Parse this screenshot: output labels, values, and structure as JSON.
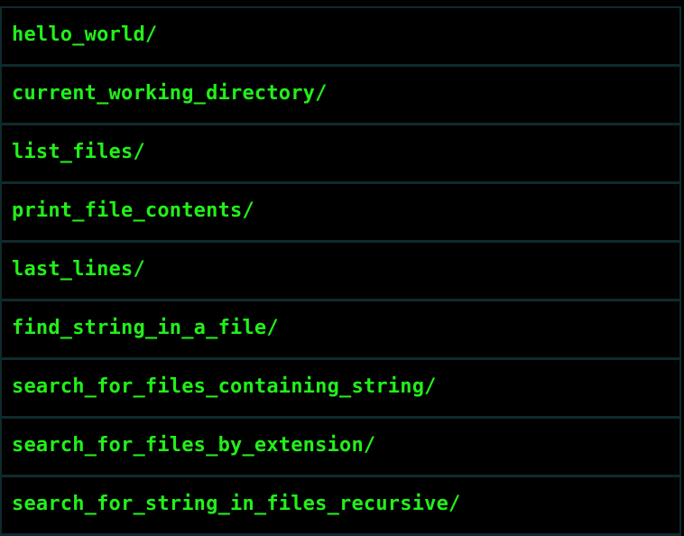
{
  "directory_listing": {
    "entries": [
      {
        "label": "hello_world/"
      },
      {
        "label": "current_working_directory/"
      },
      {
        "label": "list_files/"
      },
      {
        "label": "print_file_contents/"
      },
      {
        "label": "last_lines/"
      },
      {
        "label": "find_string_in_a_file/"
      },
      {
        "label": "search_for_files_containing_string/"
      },
      {
        "label": "search_for_files_by_extension/"
      },
      {
        "label": "search_for_string_in_files_recursive/"
      }
    ]
  },
  "colors": {
    "background": "#000000",
    "link_text": "#22f01a",
    "row_border": "#0f2a2d"
  }
}
